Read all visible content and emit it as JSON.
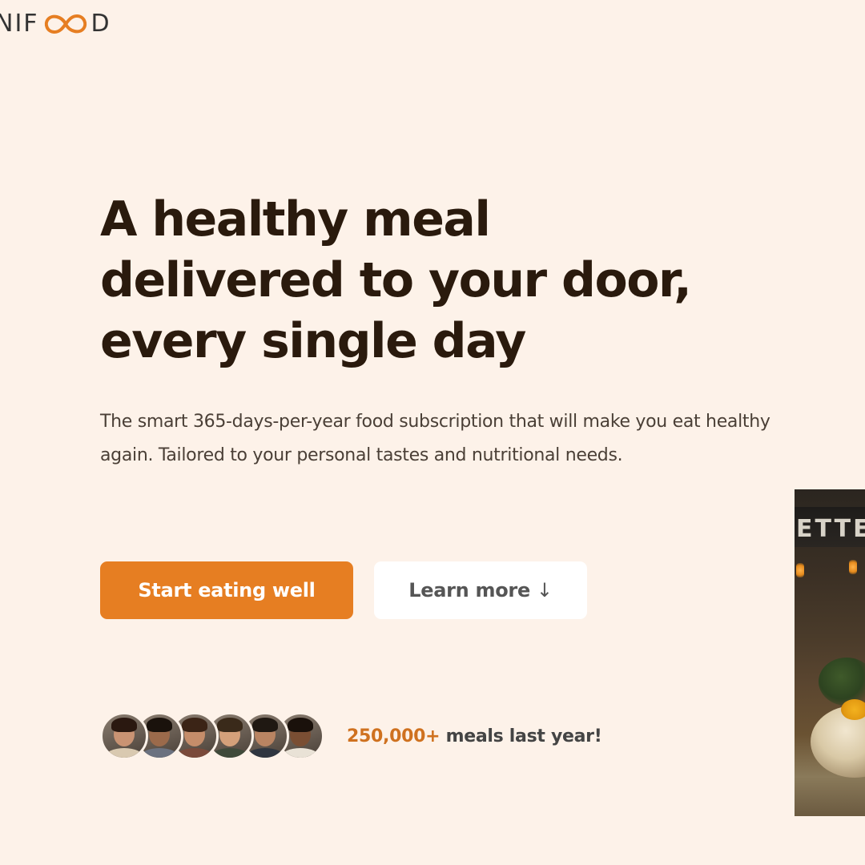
{
  "header": {
    "logo_prefix": "NIF",
    "logo_suffix": "D",
    "logo_mark_icon": "infinity-oo-icon",
    "accent_color": "#e67e22"
  },
  "hero": {
    "title_lines": [
      "A healthy meal",
      "delivered to your door,",
      "every single day"
    ],
    "description": "The smart 365-days-per-year food subscription that will make you eat healthy again. Tailored to your personal tastes and nutritional needs.",
    "primary_button": "Start eating well",
    "secondary_button": "Learn more",
    "secondary_button_icon": "↓"
  },
  "delivered": {
    "count": "250,000+",
    "label": " meals last year!",
    "customers": [
      {
        "name": "customer-1",
        "skin": "#c99373",
        "hair": "#2a1810",
        "shirt": "#d9c9b0"
      },
      {
        "name": "customer-2",
        "skin": "#9b6a4b",
        "hair": "#1a120c",
        "shirt": "#6b7280"
      },
      {
        "name": "customer-3",
        "skin": "#c58d6a",
        "hair": "#3b2416",
        "shirt": "#7a4a3a"
      },
      {
        "name": "customer-4",
        "skin": "#d4a07a",
        "hair": "#3a2a1a",
        "shirt": "#3f4a3a"
      },
      {
        "name": "customer-5",
        "skin": "#b98462",
        "hair": "#1f1812",
        "shirt": "#2f3640"
      },
      {
        "name": "customer-6",
        "skin": "#7a4e33",
        "hair": "#1a110b",
        "shirt": "#e9e2d6"
      }
    ]
  },
  "hero_image": {
    "sign_text": "ETTE",
    "alt": "restaurant food photo"
  }
}
